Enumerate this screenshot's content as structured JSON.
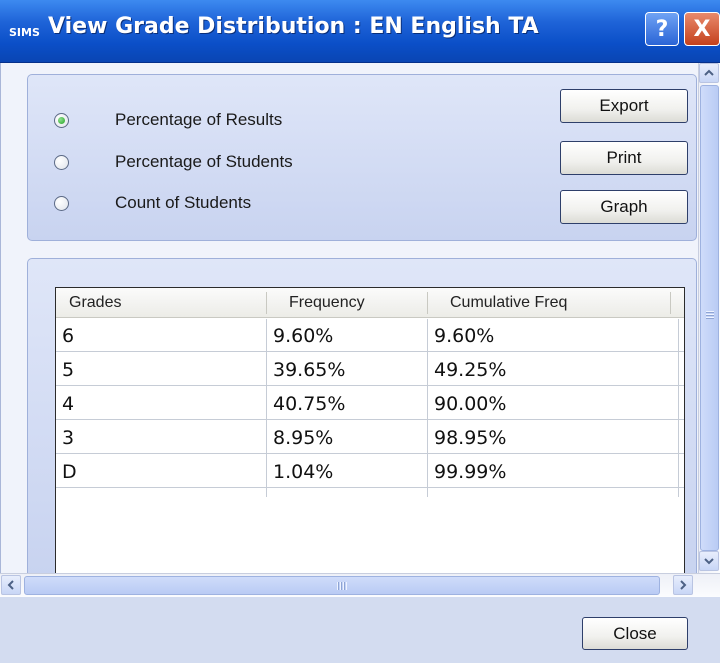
{
  "window": {
    "app_badge": "SIMS",
    "title": "View Grade Distribution : EN English TA",
    "help_glyph": "?",
    "close_glyph": "X"
  },
  "options": {
    "radios": [
      {
        "label": "Percentage of Results",
        "selected": true
      },
      {
        "label": "Percentage of Students",
        "selected": false
      },
      {
        "label": "Count of Students",
        "selected": false
      }
    ],
    "buttons": {
      "export": "Export",
      "print": "Print",
      "graph": "Graph"
    }
  },
  "grid": {
    "columns": [
      "Grades",
      "Frequency",
      "Cumulative Freq"
    ],
    "rows": [
      [
        "6",
        "9.60%",
        "9.60%"
      ],
      [
        "5",
        "39.65%",
        "49.25%"
      ],
      [
        "4",
        "40.75%",
        "90.00%"
      ],
      [
        "3",
        "8.95%",
        "98.95%"
      ],
      [
        "D",
        "1.04%",
        "99.99%"
      ]
    ]
  },
  "footer": {
    "close_label": "Close"
  },
  "colors": {
    "titlebar": "#1f64d8",
    "selected_radio": "#25a425",
    "panel": "#d3dcf0"
  },
  "icons": {
    "scroll_up": "chevron-up-icon",
    "scroll_down": "chevron-down-icon",
    "scroll_left": "chevron-left-icon",
    "scroll_right": "chevron-right-icon"
  }
}
